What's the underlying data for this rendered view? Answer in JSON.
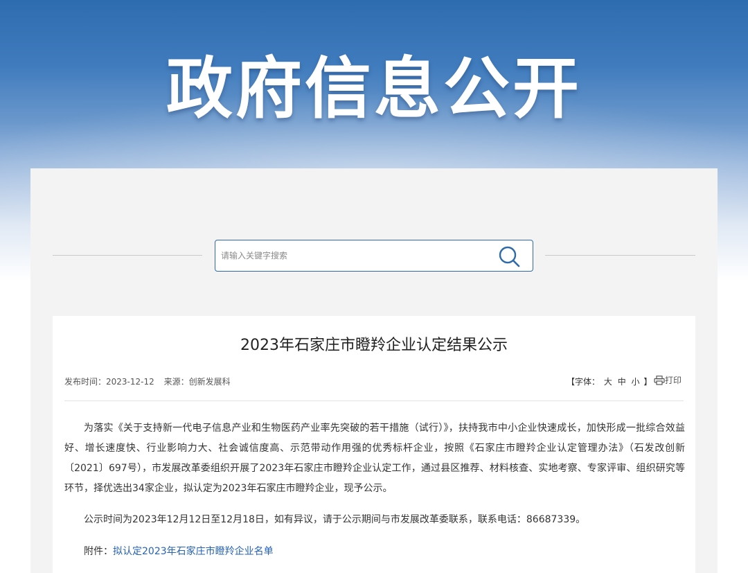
{
  "banner": {
    "title": "政府信息公开"
  },
  "search": {
    "placeholder": "请输入关键字搜索"
  },
  "article": {
    "title": "2023年石家庄市瞪羚企业认定结果公示",
    "publish_label": "发布时间：",
    "publish_date": "2023-12-12",
    "source_label": "来源：",
    "source": "创新发展科",
    "font_open": "【字体：",
    "font_large": "大",
    "font_medium": "中",
    "font_small": "小",
    "font_close": "】",
    "print_label": "打印",
    "paragraph1": "为落实《关于支持新一代电子信息产业和生物医药产业率先突破的若干措施（试行）》，扶持我市中小企业快速成长，加快形成一批综合效益好、增长速度快、行业影响力大、社会诚信度高、示范带动作用强的优秀标杆企业，按照《石家庄市瞪羚企业认定管理办法》（石发改创新〔2021〕697号），市发展改革委组织开展了2023年石家庄市瞪羚企业认定工作，通过县区推荐、材料核查、实地考察、专家评审、组织研究等环节，择优选出34家企业，拟认定为2023年石家庄市瞪羚企业，现予公示。",
    "paragraph2": "公示时间为2023年12月12日至12月18日，如有异议，请于公示期间与市发展改革委联系，联系电话：86687339。",
    "attachment_label": "附件：",
    "attachment_link": "拟认定2023年石家庄市瞪羚企业名单"
  },
  "colors": {
    "accent": "#2c6aa9",
    "link": "#2461b8"
  }
}
